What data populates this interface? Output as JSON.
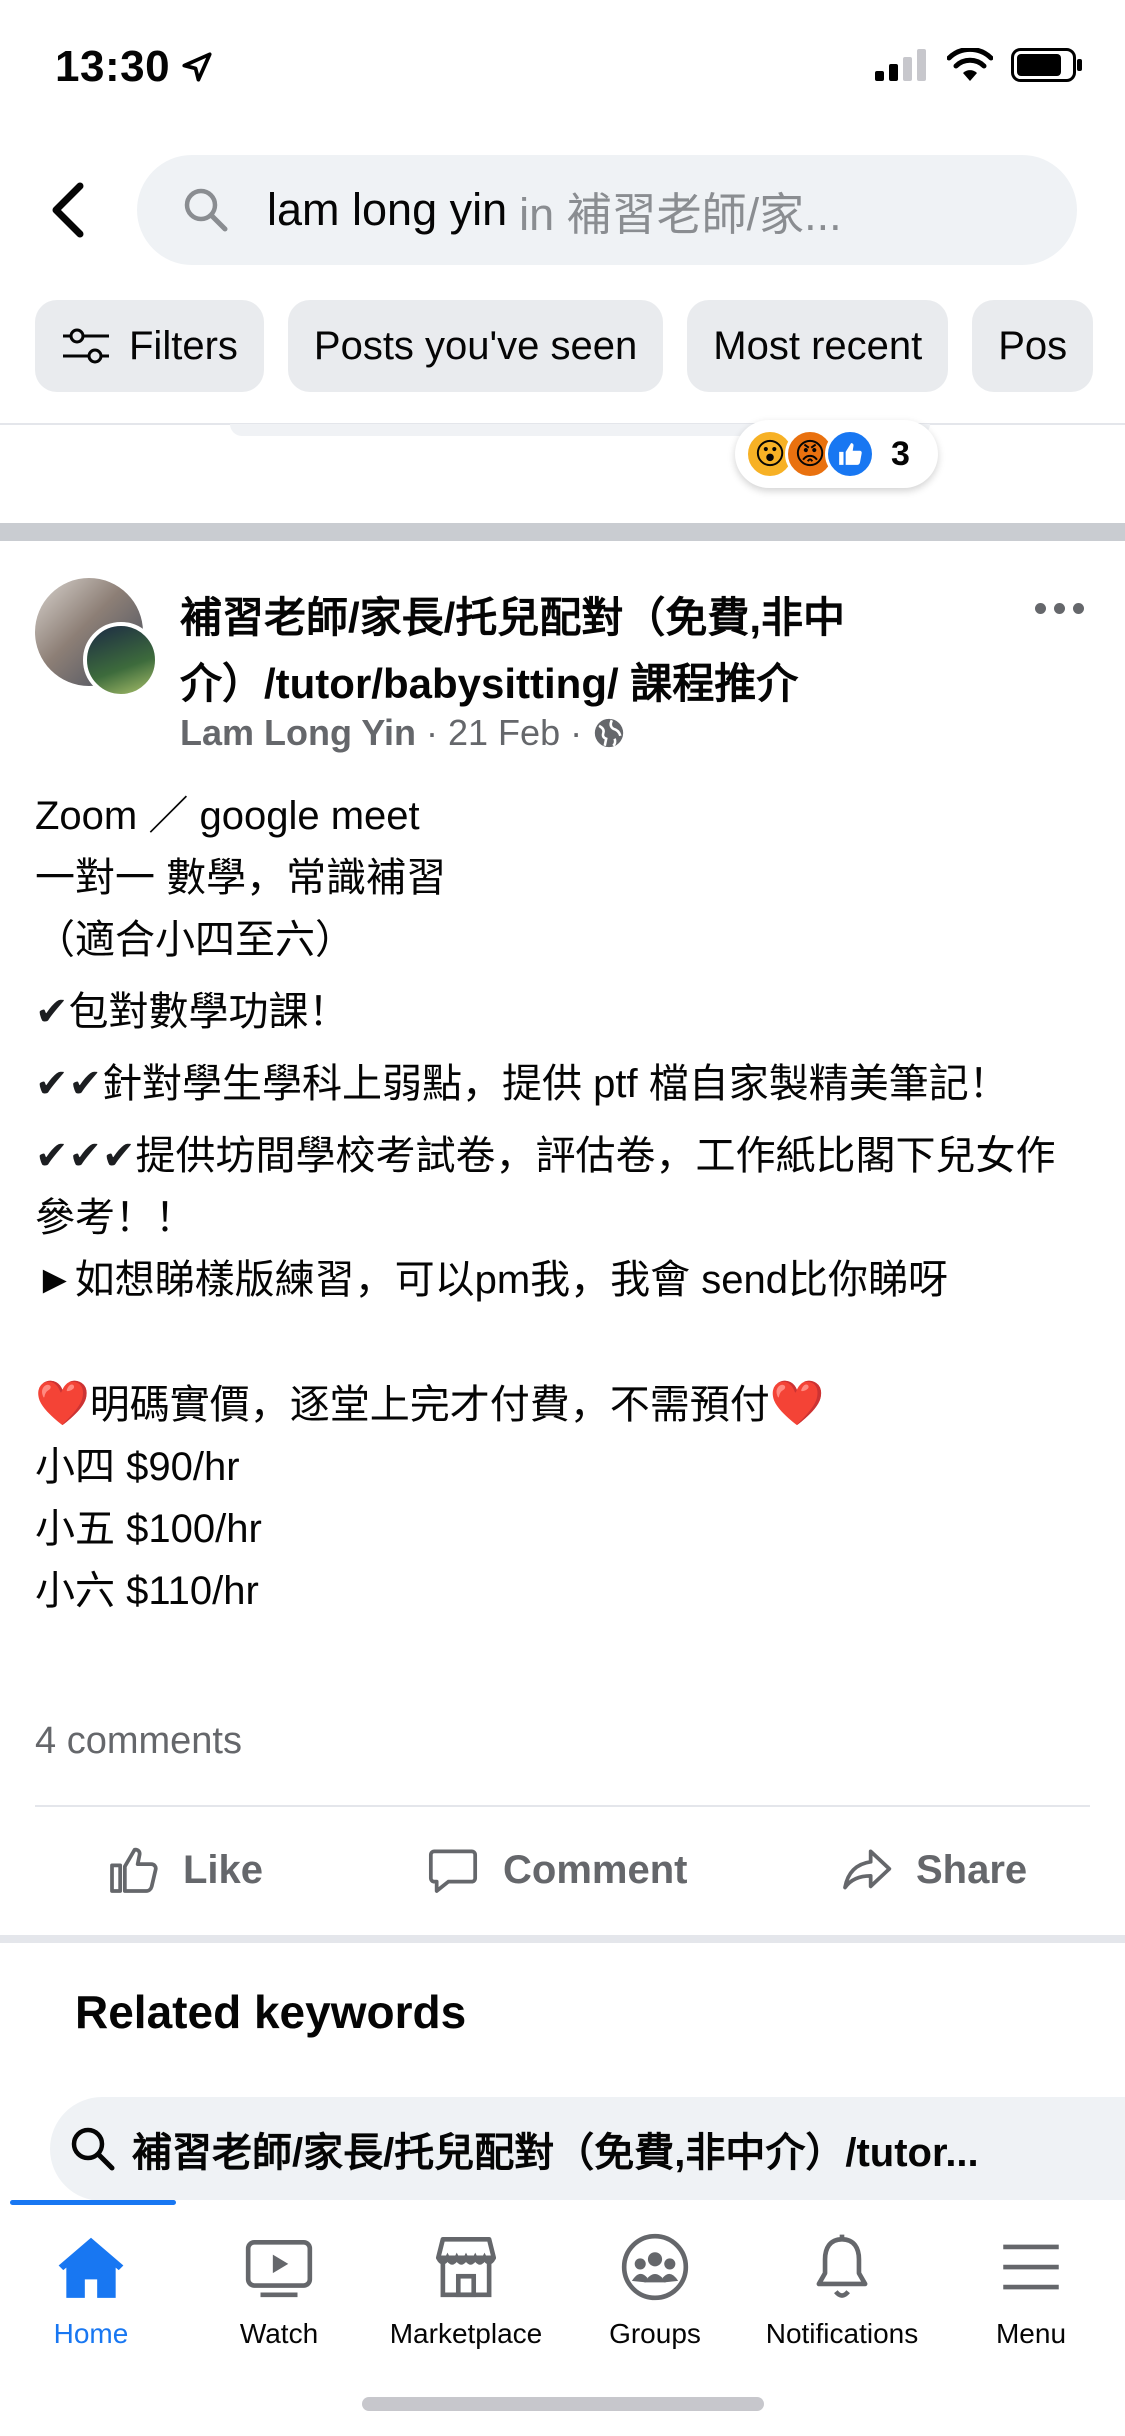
{
  "status_bar": {
    "time": "13:30"
  },
  "search": {
    "query": "lam long yin",
    "scope": "in 補習老師/家..."
  },
  "filters": [
    "Filters",
    "Posts you've seen",
    "Most recent",
    "Pos"
  ],
  "previous_post": {
    "reaction_count": "3"
  },
  "post": {
    "group_title": "補習老師/家長/托兒配對（免費,非中介）/tutor/babysitting/ 課程推介",
    "author": "Lam Long Yin",
    "date": "21 Feb",
    "separator": "·",
    "body": {
      "l1": "Zoom ／ google meet",
      "l2": "一對一 數學，常識補習",
      "l3": "（適合小四至六）",
      "c1_mark": "✔",
      "c1_text": "包對數學功課！",
      "c2_mark": "✔✔",
      "c2_text": "針對學生學科上弱點，提供 ptf 檔自家製精美筆記！",
      "c3_mark": "✔✔✔",
      "c3_text": "提供坊間學校考試卷，評估卷，工作紙比閣下兒女作參考！！",
      "arrow_line": "►如想睇樣版練習，可以pm我，我會 send比你睇呀",
      "heart": "❤️",
      "price_note": "明碼實價，逐堂上完才付費，不需預付",
      "p4": "小四 $90/hr",
      "p5": "小五 $100/hr",
      "p6": "小六 $110/hr"
    },
    "comments": "4 comments",
    "actions": {
      "like": "Like",
      "comment": "Comment",
      "share": "Share"
    }
  },
  "related": {
    "title": "Related keywords",
    "keyword": "補習老師/家長/托兒配對（免費,非中介）/tutor..."
  },
  "tabbar": {
    "tabs": [
      {
        "label": "Home",
        "icon": "home-icon",
        "active": true
      },
      {
        "label": "Watch",
        "icon": "watch-icon"
      },
      {
        "label": "Marketplace",
        "icon": "marketplace-icon"
      },
      {
        "label": "Groups",
        "icon": "groups-icon"
      },
      {
        "label": "Notifications",
        "icon": "bell-icon"
      },
      {
        "label": "Menu",
        "icon": "menu-icon"
      }
    ]
  },
  "colors": {
    "accent": "#1877f2",
    "muted": "#65676b",
    "chip_bg": "#e9ebee"
  }
}
